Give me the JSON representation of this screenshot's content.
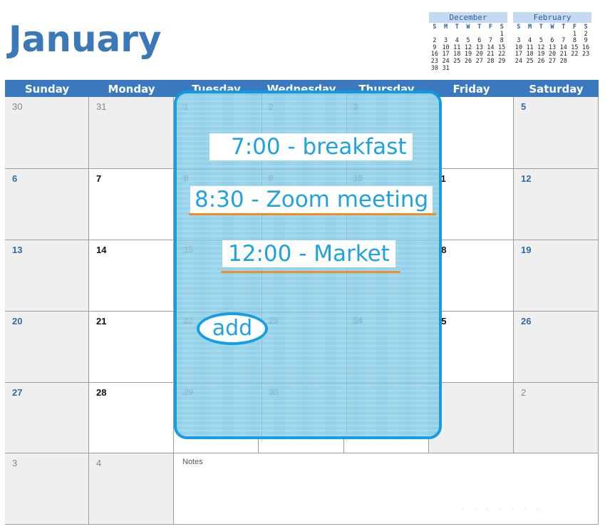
{
  "month_title": "January",
  "mini_calendars": [
    {
      "title": "December",
      "weekdays": [
        "S",
        "M",
        "T",
        "W",
        "T",
        "F",
        "S"
      ],
      "cells": [
        "",
        "",
        "",
        "",
        "",
        "",
        "1",
        "2",
        "3",
        "4",
        "5",
        "6",
        "7",
        "8",
        "9",
        "10",
        "11",
        "12",
        "13",
        "14",
        "15",
        "16",
        "17",
        "18",
        "19",
        "20",
        "21",
        "22",
        "23",
        "24",
        "25",
        "26",
        "27",
        "28",
        "29",
        "30",
        "31",
        "",
        "",
        "",
        "",
        ""
      ]
    },
    {
      "title": "February",
      "weekdays": [
        "S",
        "M",
        "T",
        "W",
        "T",
        "F",
        "S"
      ],
      "cells": [
        "",
        "",
        "",
        "",
        "",
        "1",
        "2",
        "3",
        "4",
        "5",
        "6",
        "7",
        "8",
        "9",
        "10",
        "11",
        "12",
        "13",
        "14",
        "15",
        "16",
        "17",
        "18",
        "19",
        "20",
        "21",
        "22",
        "23",
        "24",
        "25",
        "26",
        "27",
        "28",
        "",
        "",
        "",
        "",
        "",
        ""
      ]
    }
  ],
  "weekdays": [
    "Sunday",
    "Monday",
    "Tuesday",
    "Wednesday",
    "Thursday",
    "Friday",
    "Saturday"
  ],
  "weeks": [
    [
      "30",
      "31",
      "1",
      "2",
      "3",
      "4",
      "5"
    ],
    [
      "6",
      "7",
      "8",
      "9",
      "10",
      "11",
      "12"
    ],
    [
      "13",
      "14",
      "15",
      "16",
      "17",
      "18",
      "19"
    ],
    [
      "20",
      "21",
      "22",
      "23",
      "24",
      "25",
      "26"
    ],
    [
      "27",
      "28",
      "29",
      "30",
      "",
      "1",
      "2"
    ],
    [
      "3",
      "4"
    ]
  ],
  "notes_label": "Notes",
  "overlay": {
    "events": [
      {
        "text": "7:00 - breakfast",
        "underlined": false
      },
      {
        "text": "8:30 - Zoom meeting",
        "underlined": true
      },
      {
        "text": "12:00 - Market",
        "underlined": true
      }
    ],
    "add_label": "add",
    "colors": {
      "panel_border": "#0e9be0",
      "panel_fill": "#8fd0ea",
      "event_text": "#1a9fe0",
      "underline": "#f08a1e"
    }
  },
  "colors": {
    "header_bar": "#3a79bf",
    "title": "#3a78b8",
    "weekend_number": "#2e6aa8"
  }
}
